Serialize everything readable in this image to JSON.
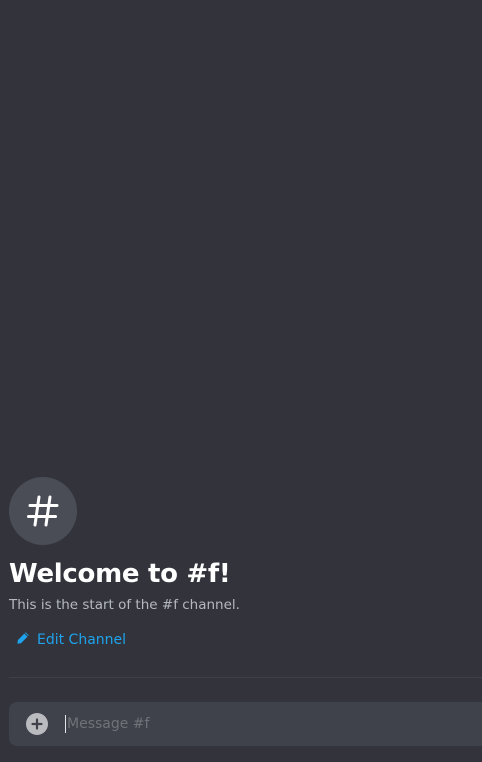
{
  "welcome": {
    "title": "Welcome to #f!",
    "subtitle": "This is the start of the #f channel.",
    "edit_channel_label": "Edit Channel",
    "avatar_icon": "hash-icon"
  },
  "composer": {
    "placeholder": "Message #f",
    "value": "",
    "add_icon": "plus-circle-icon"
  },
  "colors": {
    "background": "#32333b",
    "accent_link": "#1ea3ec",
    "composer_bg": "#40424b",
    "avatar_bg": "#4a4d55"
  }
}
